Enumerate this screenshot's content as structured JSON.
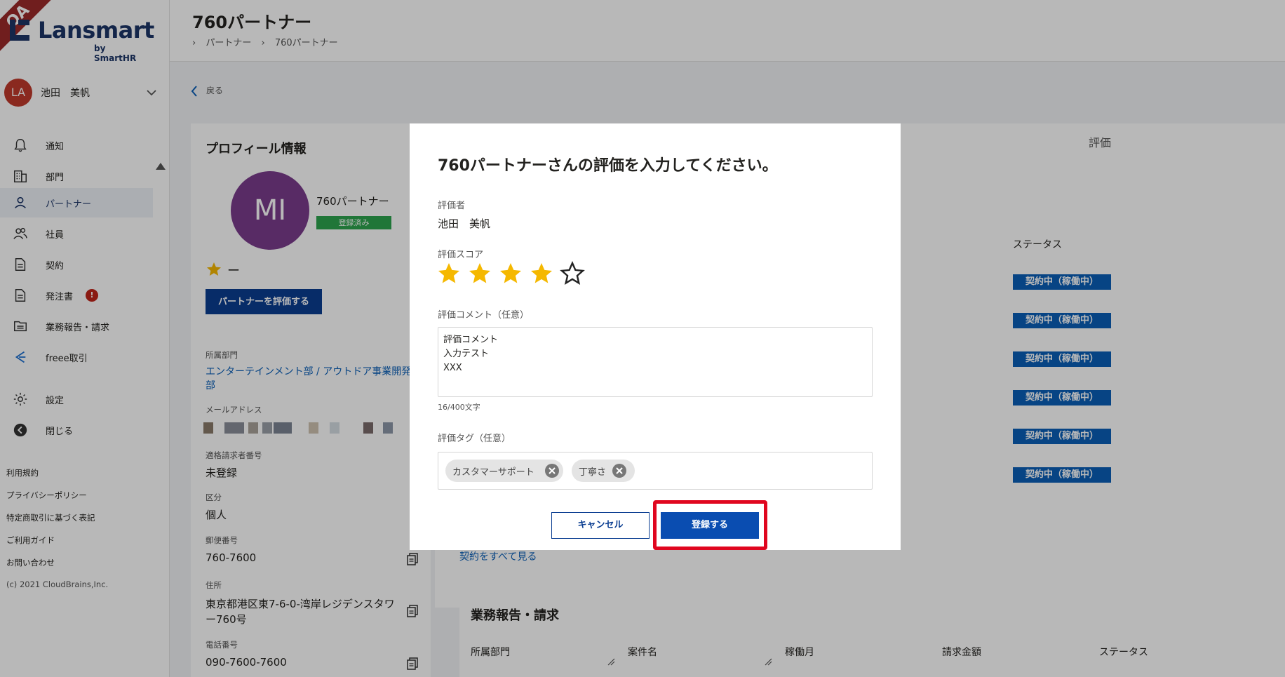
{
  "app": {
    "logo_text": "Lansmart",
    "logo_sub": "by SmartHR",
    "env_ribbon": "QA"
  },
  "user": {
    "initials": "LA",
    "name": "池田　美帆"
  },
  "nav": [
    {
      "label": "通知",
      "icon": "bell-icon"
    },
    {
      "label": "部門",
      "icon": "building-icon"
    },
    {
      "label": "パートナー",
      "icon": "person-icon",
      "active": true
    },
    {
      "label": "社員",
      "icon": "people-icon"
    },
    {
      "label": "契約",
      "icon": "document-icon"
    },
    {
      "label": "発注書",
      "icon": "document-icon",
      "badge": "!"
    },
    {
      "label": "業務報告・請求",
      "icon": "folder-icon"
    },
    {
      "label": "freee取引",
      "icon": "freee-icon"
    },
    {
      "label": "設定",
      "icon": "gear-icon"
    },
    {
      "label": "閉じる",
      "icon": "arrow-left-circle-icon"
    }
  ],
  "footer_links": [
    "利用規約",
    "プライバシーポリシー",
    "特定商取引に基づく表記",
    "ご利用ガイド",
    "お問い合わせ"
  ],
  "copyright": "(c) 2021 CloudBrains,Inc.",
  "header": {
    "title": "760パートナー",
    "breadcrumb": [
      "パートナー",
      "760パートナー"
    ]
  },
  "back_label": "戻る",
  "profile": {
    "title": "プロフィール情報",
    "initials": "MI",
    "name": "760パートナー",
    "badge": "登録済み",
    "score": "ー",
    "rate_button": "パートナーを評価する",
    "department_label": "所属部門",
    "department_value": "エンターテインメント部 / アウトドア事業開発部",
    "email_label": "メールアドレス",
    "invoice_label": "適格請求者番号",
    "invoice_value": "未登録",
    "type_label": "区分",
    "type_value": "個人",
    "postal_label": "郵便番号",
    "postal_value": "760-7600",
    "address_label": "住所",
    "address_value": "東京都港区東7-6-0-湾岸レジデンスタワー760号",
    "phone_label": "電話番号",
    "phone_value": "090-7600-7600"
  },
  "right": {
    "rating_tab": "評価",
    "status_header": "ステータス",
    "status_tags": [
      "契約中（稼働中）",
      "契約中（稼働中）",
      "契約中（稼働中）",
      "契約中（稼働中）",
      "契約中（稼働中）",
      "契約中（稼働中）"
    ],
    "see_all": "契約をすべて見る",
    "report_title": "業務報告・請求",
    "report_columns": [
      "所属部門",
      "案件名",
      "稼働月",
      "請求金額",
      "ステータス"
    ]
  },
  "modal": {
    "title": "760パートナーさんの評価を入力してください。",
    "rater_label": "評価者",
    "rater_value": "池田　美帆",
    "score_label": "評価スコア",
    "score_value": 4,
    "score_max": 5,
    "comment_label": "評価コメント（任意）",
    "comment_value": "評価コメント\n入力テスト\nXXX",
    "char_count": "16/400文字",
    "tag_label": "評価タグ（任意）",
    "tags": [
      "カスタマーサポート",
      "丁寧さ"
    ],
    "cancel_label": "キャンセル",
    "submit_label": "登録する"
  },
  "colors": {
    "brand": "#1c3567",
    "primary": "#0a4db1",
    "star": "#f5b800",
    "highlight": "#e0061f",
    "registered": "#2da44e"
  }
}
